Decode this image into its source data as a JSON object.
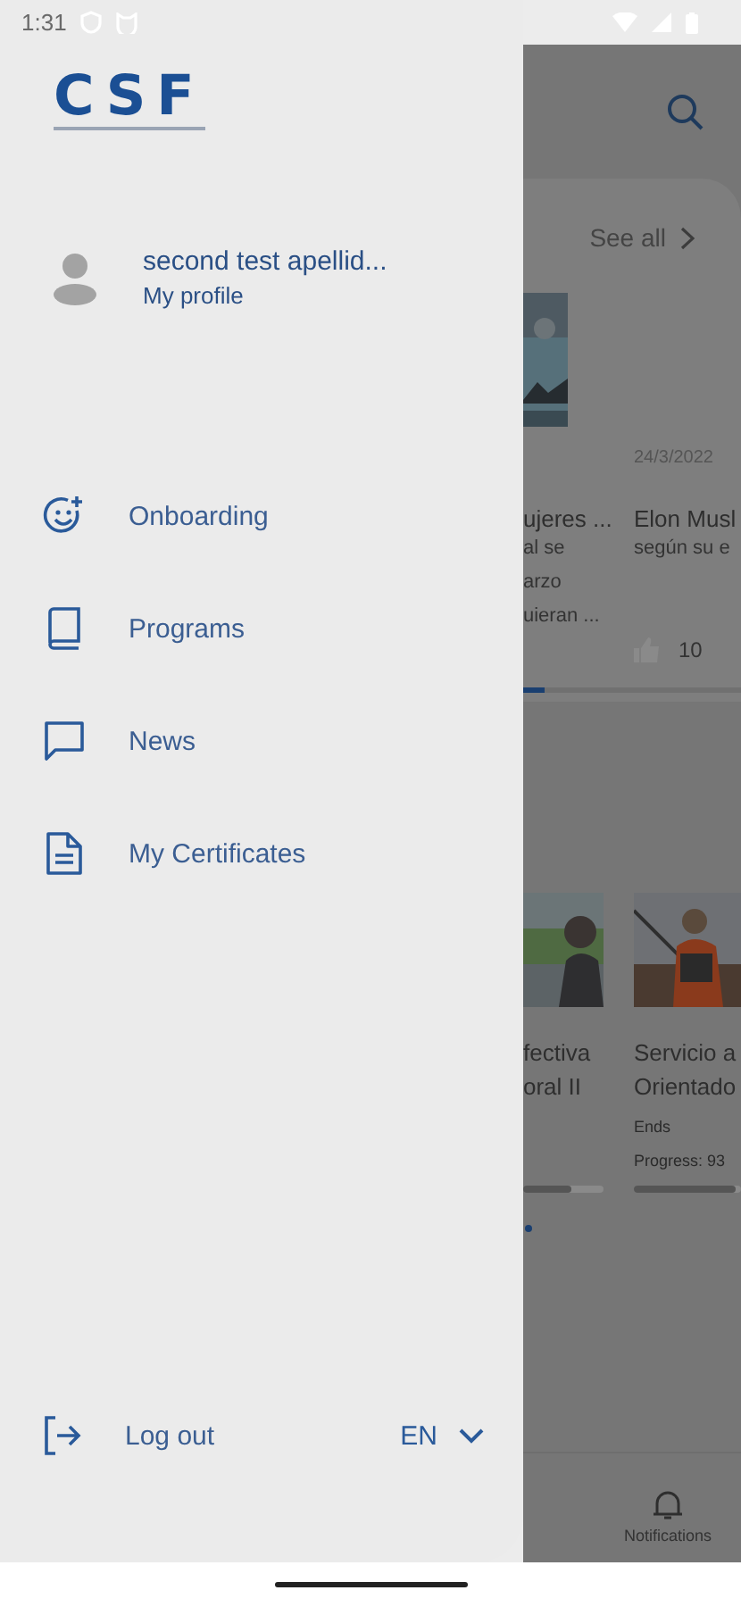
{
  "status_bar": {
    "time": "1:31"
  },
  "drawer": {
    "logo": "CSF",
    "profile": {
      "name": "second test apellid...",
      "link": "My profile"
    },
    "menu": [
      {
        "label": "Onboarding",
        "kind": "smiley"
      },
      {
        "label": "Programs",
        "kind": "book"
      },
      {
        "label": "News",
        "kind": "chat"
      },
      {
        "label": "My Certificates",
        "kind": "document"
      }
    ],
    "logout": "Log out",
    "language": "EN"
  },
  "background": {
    "see_all": "See all",
    "news": [
      {
        "title": "ujeres ...",
        "excerpt": [
          "al se",
          "arzo",
          "uieran ..."
        ]
      },
      {
        "date": "24/3/2022",
        "title": "Elon Musl",
        "excerpt": [
          "según su e"
        ],
        "likes": "10"
      }
    ],
    "programs": [
      {
        "title": [
          "fectiva",
          "oral II"
        ],
        "level": 0.6
      },
      {
        "title": [
          "Servicio a",
          "Orientado"
        ],
        "ends": "Ends",
        "progress": "Progress: 93",
        "level": 0.95
      }
    ],
    "nav_label": "Notifications"
  }
}
